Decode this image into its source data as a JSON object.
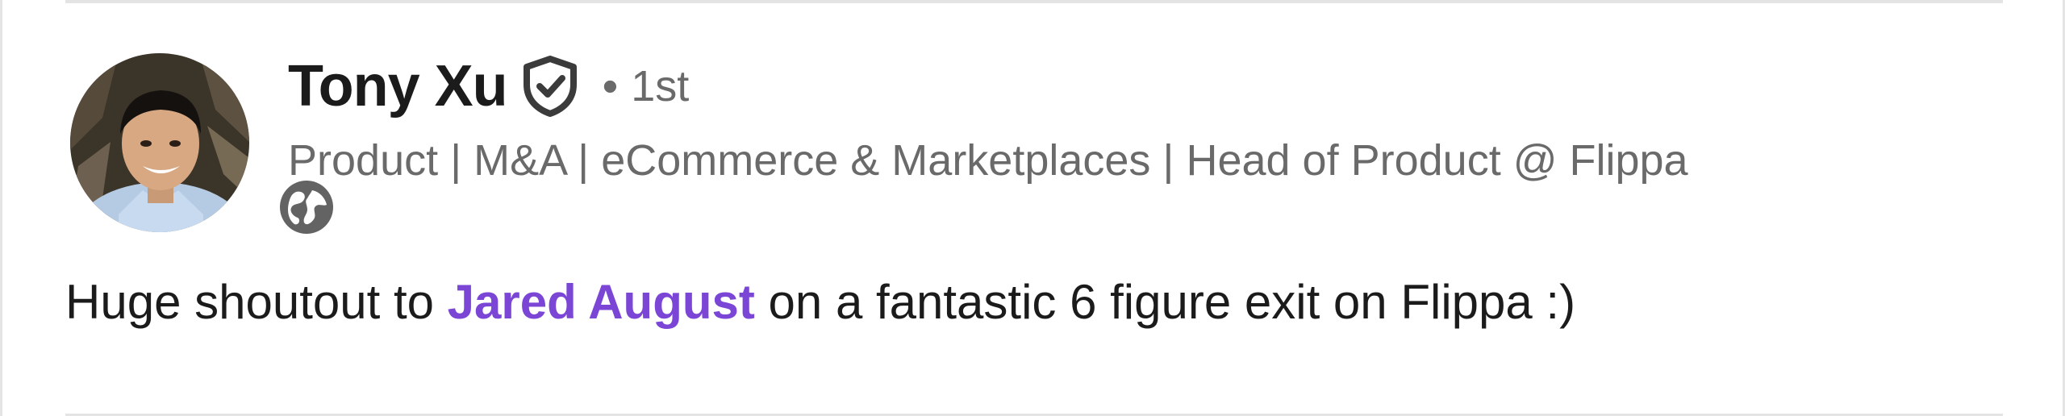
{
  "author": {
    "name": "Tony Xu",
    "connection_degree": "1st",
    "separator": "•",
    "headline": "Product | M&A | eCommerce & Marketplaces | Head of Product @ Flippa",
    "verified_icon": "shield-check-icon",
    "visibility_icon": "globe-icon"
  },
  "post": {
    "text_before": "Huge shoutout to ",
    "mention": "Jared August",
    "text_after": " on a fantastic 6 figure exit on Flippa :)"
  },
  "colors": {
    "mention": "#7b45d6",
    "primary_text": "#1b1b1b",
    "secondary_text": "#6a6a6a",
    "divider": "#e4e4e4"
  }
}
